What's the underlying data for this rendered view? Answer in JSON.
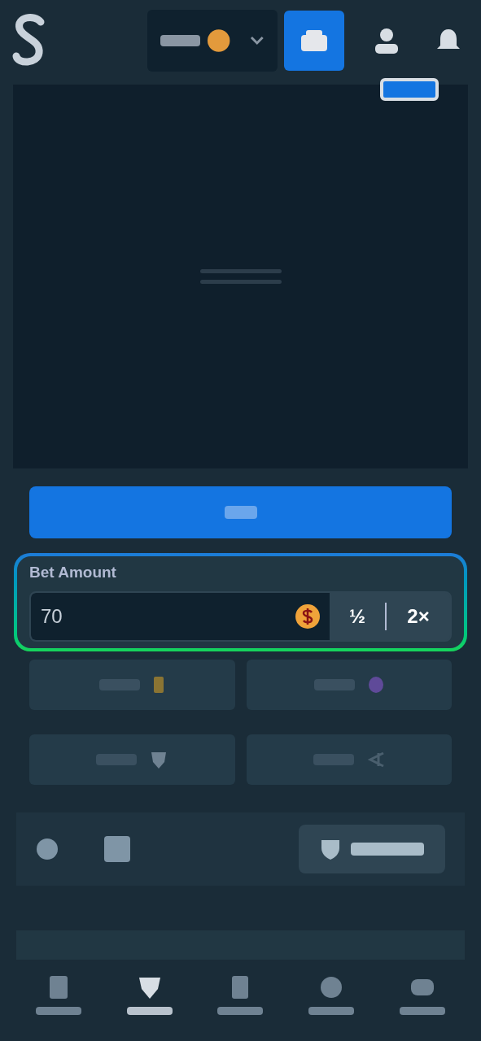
{
  "bet_amount": {
    "label": "Bet Amount",
    "value": "70",
    "half": "½",
    "double": "2×",
    "highlighted": true
  },
  "actions": [
    {
      "kind": "card"
    },
    {
      "kind": "hand"
    },
    {
      "kind": "shield"
    },
    {
      "kind": "arrow"
    }
  ],
  "nav": [
    {
      "kind": "book",
      "selected": false
    },
    {
      "kind": "shield",
      "selected": true
    },
    {
      "kind": "ticket",
      "selected": false
    },
    {
      "kind": "ball",
      "selected": false
    },
    {
      "kind": "chat",
      "selected": false
    }
  ]
}
